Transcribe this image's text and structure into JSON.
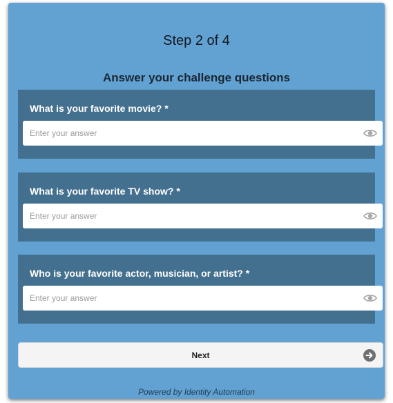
{
  "header": {
    "step": "Step 2 of 4",
    "subtitle": "Answer your challenge questions"
  },
  "questions": [
    {
      "label": "What is your favorite movie? *",
      "value": "",
      "placeholder": "Enter your answer",
      "icon": "eye-icon"
    },
    {
      "label": "What is your favorite TV show? *",
      "value": "",
      "placeholder": "Enter your answer",
      "icon": "eye-icon"
    },
    {
      "label": "Who is your favorite actor, musician, or artist? *",
      "value": "",
      "placeholder": "Enter your answer",
      "icon": "eye-icon"
    }
  ],
  "next_button": {
    "label": "Next",
    "icon": "arrow-right-circle-icon"
  },
  "footer": {
    "text": "Powered by Identity Automation"
  },
  "colors": {
    "card_background": "#62a2d2",
    "question_block": "#44708f",
    "button_background": "#f4f4f4"
  }
}
